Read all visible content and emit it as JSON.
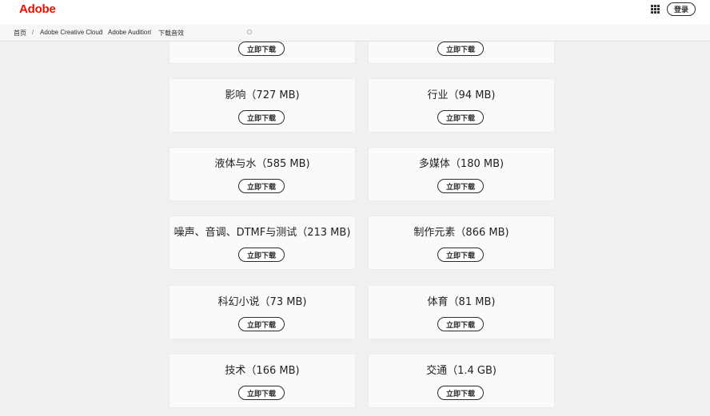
{
  "header": {
    "logo": "Adobe",
    "apps_icon": "apps-grid-icon",
    "signin_label": "登录",
    "brand_color": "#eb1000"
  },
  "breadcrumb": [
    "首页",
    "Adobe Creative Cloud",
    "Adobe Audition",
    "下载音效"
  ],
  "breadcrumb_separator": "/",
  "download_label": "立即下载",
  "cards": [
    {
      "title": ""
    },
    {
      "title": ""
    },
    {
      "title": "影响（727 MB)"
    },
    {
      "title": "行业（94 MB)"
    },
    {
      "title": "液体与水（585 MB)"
    },
    {
      "title": "多媒体（180 MB)"
    },
    {
      "title": "噪声、音调、DTMF与测试（213 MB)"
    },
    {
      "title": "制作元素（866 MB)"
    },
    {
      "title": "科幻小说（73 MB)"
    },
    {
      "title": "体育（81 MB)"
    },
    {
      "title": "技术（166 MB)"
    },
    {
      "title": "交通（1.4 GB)"
    }
  ]
}
